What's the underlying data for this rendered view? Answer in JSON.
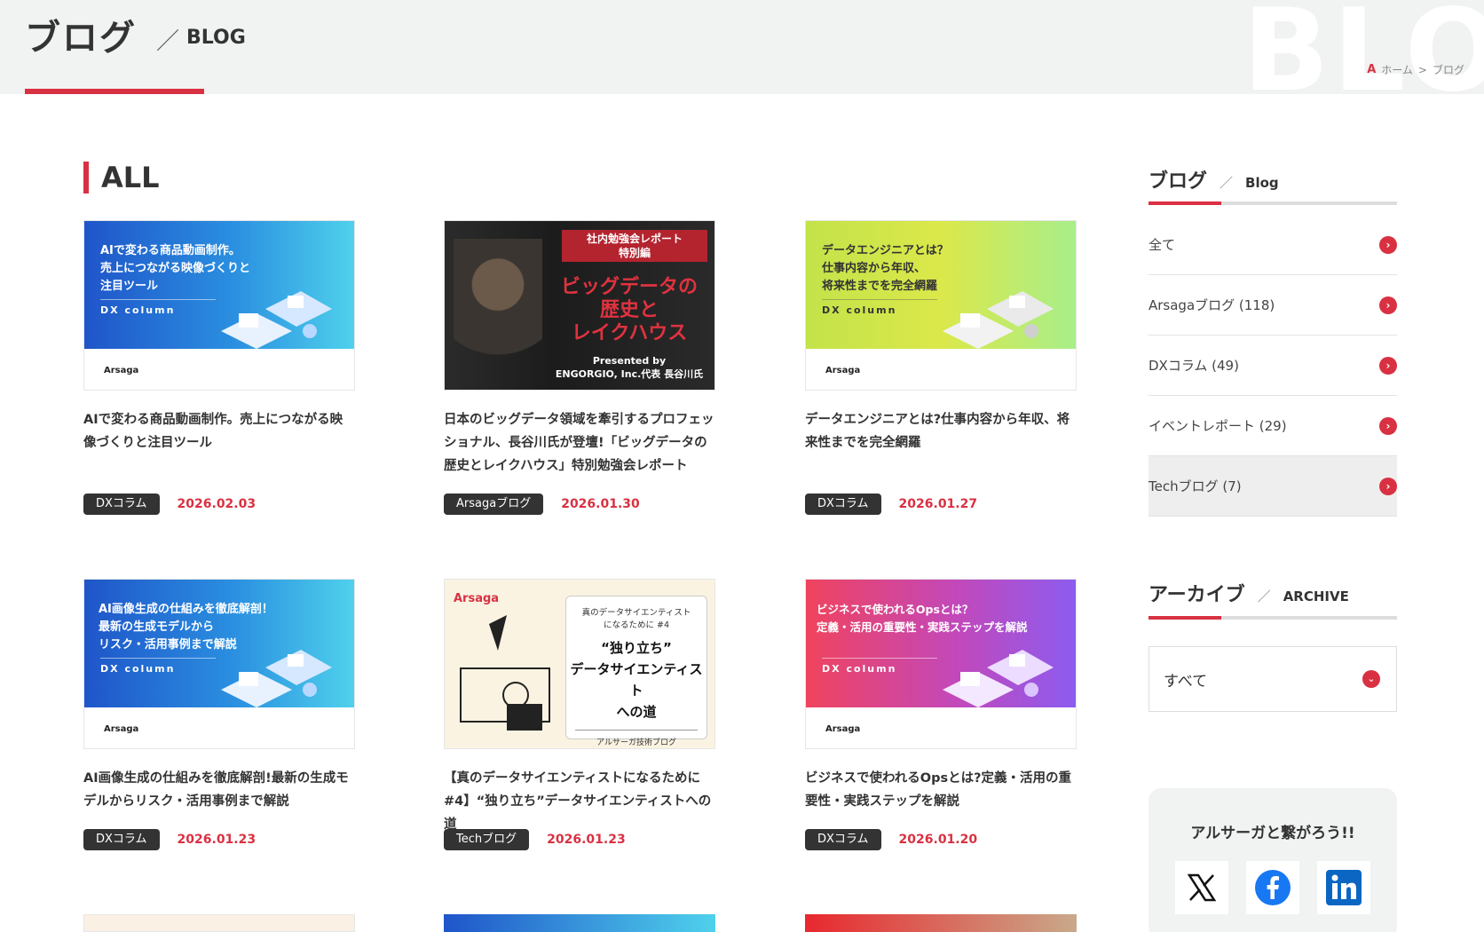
{
  "header": {
    "title": "ブログ",
    "separator": "／",
    "subtitle": "BLOG",
    "bg_word": "BLOG",
    "breadcrumb": {
      "home": "ホーム",
      "sep": ">",
      "current": "ブログ"
    }
  },
  "section": {
    "title": "ALL"
  },
  "cards": [
    {
      "thumb_text": "AIで変わる商品動画制作。\n売上につながる映像づくりと\n注目ツール",
      "thumb_sub": "DX column",
      "logo": "Arsaga",
      "title": "AIで変わる商品動画制作。売上につながる映像づくりと注目ツール",
      "tag": "DXコラム",
      "date": "2026.02.03"
    },
    {
      "thumb_text": "社内勉強会レポート\n特別編",
      "thumb_main": "ビッグデータの\n歴史と\nレイクハウス",
      "thumb_credit": "Presented by\nENGORGIO, Inc.代表 長谷川氏",
      "title": "日本のビッグデータ領域を牽引するプロフェッショナル、長谷川氏が登壇!「ビッグデータの歴史とレイクハウス」特別勉強会レポート",
      "tag": "Arsagaブログ",
      "date": "2026.01.30"
    },
    {
      "thumb_text": "データエンジニアとは？\n仕事内容から年収、\n将来性までを完全網羅",
      "thumb_sub": "DX column",
      "logo": "Arsaga",
      "title": "データエンジニアとは?仕事内容から年収、将来性までを完全網羅",
      "tag": "DXコラム",
      "date": "2026.01.27"
    },
    {
      "thumb_text": "AI画像生成の仕組みを徹底解剖！\n最新の生成モデルから\nリスク・活用事例まで解説",
      "thumb_sub": "DX column",
      "logo": "Arsaga",
      "title": "AI画像生成の仕組みを徹底解剖!最新の生成モデルからリスク・活用事例まで解説",
      "tag": "DXコラム",
      "date": "2026.01.23"
    },
    {
      "logo": "Arsaga",
      "thumb_small": "真のデータサイエンティスト\nになるために #4",
      "thumb_main": "“独り立ち”\nデータサイエンティスト\nへの道",
      "thumb_foot": "アルサーガ技術ブログ",
      "title": "【真のデータサイエンティストになるために#4】“独り立ち”データサイエンティストへの道",
      "tag": "Techブログ",
      "date": "2026.01.23"
    },
    {
      "thumb_text": "ビジネスで使われるOpsとは？\n定義・活用の重要性・実践ステップを解説",
      "thumb_sub": "DX column",
      "logo": "Arsaga",
      "title": "ビジネスで使われるOpsとは?定義・活用の重要性・実践ステップを解説",
      "tag": "DXコラム",
      "date": "2026.01.20"
    }
  ],
  "sidebar": {
    "blog_head": {
      "title": "ブログ",
      "sep": "／",
      "en": "Blog"
    },
    "categories": [
      {
        "label": "全て"
      },
      {
        "label": "Arsagaブログ (118)"
      },
      {
        "label": "DXコラム (49)"
      },
      {
        "label": "イベントレポート (29)"
      },
      {
        "label": "Techブログ (7)"
      }
    ],
    "archive_head": {
      "title": "アーカイブ",
      "sep": "／",
      "en": "ARCHIVE"
    },
    "archive_selected": "すべて",
    "social_title": "アルサーガと繋がろう!!"
  },
  "colors": {
    "accent": "#d93142",
    "dark_tag": "#333333",
    "header_bg": "#f1f2f2"
  }
}
